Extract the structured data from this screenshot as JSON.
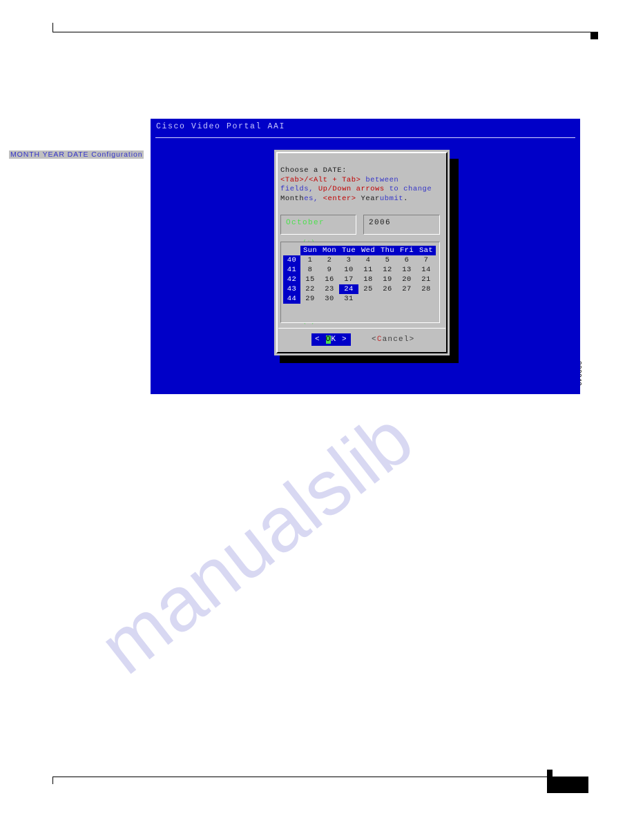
{
  "page": {
    "figure_id": "200040"
  },
  "watermark": {
    "text": "manualslib"
  },
  "terminal": {
    "title": "Cisco Video Portal AAI"
  },
  "dialog": {
    "title": "MONTH  YEAR DATE Configuration",
    "instructions": {
      "line1": "Choose a DATE:",
      "line2_a": "<Tab>/<Alt + Tab>",
      "line2_b": " between",
      "line3_a": "fields, ",
      "line3_b": "Up/Down arrows",
      "line3_c": " to change",
      "line4_a": "Month",
      "line4_b": "es, ",
      "line4_c": "<enter>",
      "line4_d": " Year",
      "line4_e": "ubmit",
      "line4_f": "."
    },
    "fields": {
      "month_value": "October",
      "year_value": "2006"
    },
    "calendar": {
      "scroll_up_hint": "-(+)-",
      "scroll_down_hint": "-(+)-",
      "day_headers": [
        "Sun",
        "Mon",
        "Tue",
        "Wed",
        "Thu",
        "Fri",
        "Sat"
      ],
      "week_numbers": [
        "40",
        "41",
        "42",
        "43",
        "44"
      ],
      "rows": [
        [
          "1",
          "2",
          "3",
          "4",
          "5",
          "6",
          "7"
        ],
        [
          "8",
          "9",
          "10",
          "11",
          "12",
          "13",
          "14"
        ],
        [
          "15",
          "16",
          "17",
          "18",
          "19",
          "20",
          "21"
        ],
        [
          "22",
          "23",
          "24",
          "25",
          "26",
          "27",
          "28"
        ],
        [
          "29",
          "30",
          "31",
          "",
          "",
          "",
          ""
        ]
      ],
      "selected_day": "24"
    },
    "buttons": {
      "ok_prefix": "< ",
      "ok_hotkey": "O",
      "ok_rest": "K ",
      "ok_suffix": ">",
      "cancel_prefix": "<",
      "cancel_hotkey": "C",
      "cancel_rest": "ancel>"
    }
  },
  "colors": {
    "terminal_blue": "#0000c8",
    "dialog_gray": "#c0c0c0",
    "highlight_green": "#4ee04e",
    "text_red": "#c00000",
    "text_blue": "#3434c8",
    "watermark": "#d8d8f2"
  }
}
